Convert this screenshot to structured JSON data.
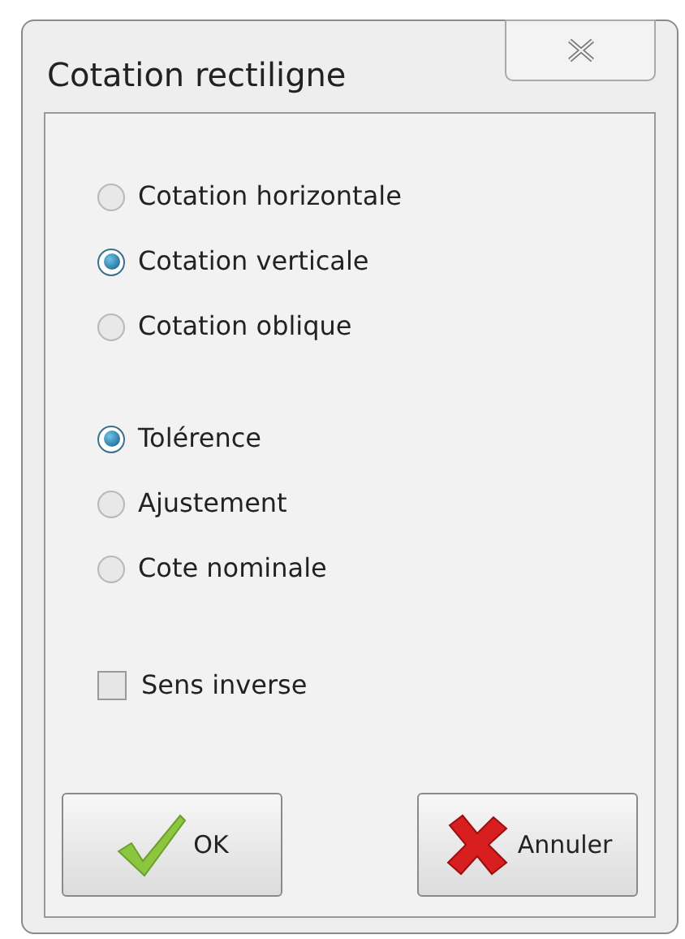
{
  "window": {
    "title": "Cotation rectiligne"
  },
  "groups": [
    {
      "options": [
        {
          "label": "Cotation horizontale",
          "selected": false
        },
        {
          "label": "Cotation verticale",
          "selected": true
        },
        {
          "label": "Cotation oblique",
          "selected": false
        }
      ]
    },
    {
      "options": [
        {
          "label": "Tolérence",
          "selected": true
        },
        {
          "label": "Ajustement",
          "selected": false
        },
        {
          "label": "Cote nominale",
          "selected": false
        }
      ]
    }
  ],
  "checkbox": {
    "label": "Sens inverse",
    "checked": false
  },
  "buttons": [
    {
      "kind": "ok",
      "label": "OK"
    },
    {
      "kind": "cancel",
      "label": "Annuler"
    }
  ]
}
